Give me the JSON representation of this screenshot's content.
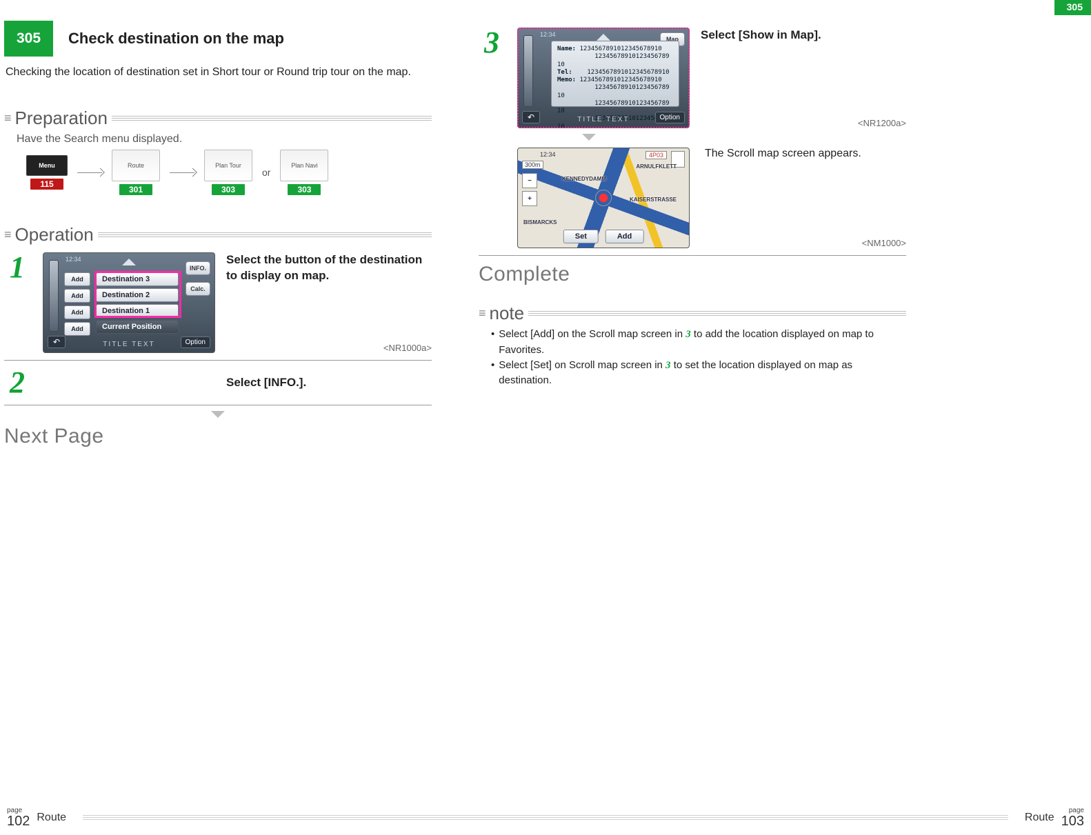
{
  "top_tab": "305",
  "header": {
    "page_number": "305",
    "title": "Check destination on the map",
    "description": "Checking the location of destination set in Short tour or Round trip tour on the map."
  },
  "preparation": {
    "label": "Preparation",
    "instruction": "Have the Search menu displayed.",
    "items": {
      "menu": {
        "thumb": "Menu",
        "ref": "115"
      },
      "route": {
        "thumb": "Route",
        "ref": "301"
      },
      "plan_tour": {
        "thumb": "Plan Tour",
        "ref": "303"
      },
      "plan_navi": {
        "thumb": "Plan Navi",
        "ref": "303"
      }
    },
    "or": "or"
  },
  "operation": {
    "label": "Operation"
  },
  "steps": {
    "s1": {
      "num": "1",
      "text": "Select the button of the destination to display on map.",
      "screen_id": "<NR1000a>",
      "shot": {
        "clock": "12:34",
        "add": "Add",
        "destinations": [
          "Destination 3",
          "Destination 2",
          "Destination 1"
        ],
        "current": "Current Position",
        "title": "TITLE TEXT",
        "info_btn": "INFO.",
        "calc_btn": "Calc.",
        "option": "Option"
      }
    },
    "s2": {
      "num": "2",
      "text": "Select [INFO.]."
    },
    "s3": {
      "num": "3",
      "text": "Select [Show in Map].",
      "screen_id": "<NR1200a>",
      "shot": {
        "clock": "12:34",
        "map_btn": "Map",
        "name_label": "Name:",
        "tel_label": "Tel:",
        "memo_label": "Memo:",
        "filler": "12345678910123456789​10",
        "title": "TITLE TEXT",
        "option": "Option"
      }
    },
    "s4": {
      "result": "The Scroll map screen appears.",
      "screen_id": "<NM1000>",
      "shot": {
        "clock": "12:34",
        "scale": "300m",
        "set": "Set",
        "add": "Add",
        "poi_tag": "4P03",
        "place1": "KENNEDYDAMM",
        "place2": "KAISERSTRASSE",
        "place3": "BISMARCKS",
        "place4": "ARNULFKLETT"
      }
    }
  },
  "next_page": "Next Page",
  "complete": "Complete",
  "note": {
    "label": "note",
    "lines": {
      "l1a": "Select [Add] on the Scroll map screen in ",
      "l1b": " to add the location displayed on map to Favorites.",
      "l2a": "Select [Set] on Scroll map screen in ",
      "l2b": " to set the location displayed on map as destination.",
      "ref": "3"
    }
  },
  "footer": {
    "left_page_label": "page",
    "left_page": "102",
    "right_page_label": "page",
    "right_page": "103",
    "category": "Route"
  }
}
